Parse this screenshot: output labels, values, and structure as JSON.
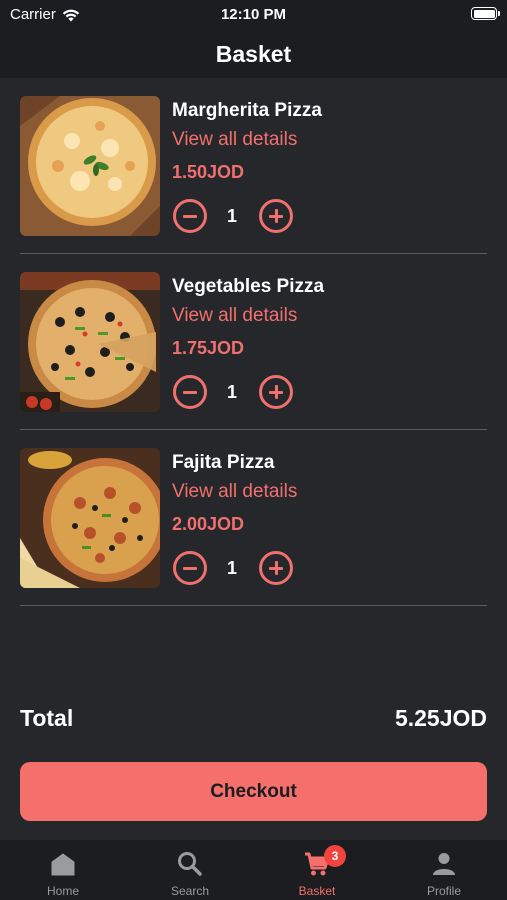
{
  "status_bar": {
    "carrier": "Carrier",
    "time": "12:10 PM"
  },
  "header": {
    "title": "Basket"
  },
  "items": [
    {
      "name": "Margherita Pizza",
      "link": "View all details",
      "price": "1.50JOD",
      "quantity": "1"
    },
    {
      "name": "Vegetables Pizza",
      "link": "View all details",
      "price": "1.75JOD",
      "quantity": "1"
    },
    {
      "name": "Fajita Pizza",
      "link": "View all details",
      "price": "2.00JOD",
      "quantity": "1"
    }
  ],
  "total": {
    "label": "Total",
    "value": "5.25JOD"
  },
  "checkout": {
    "label": "Checkout"
  },
  "tabs": [
    {
      "label": "Home",
      "icon": "home-icon"
    },
    {
      "label": "Search",
      "icon": "search-icon"
    },
    {
      "label": "Basket",
      "icon": "cart-icon",
      "badge": "3",
      "active": true
    },
    {
      "label": "Profile",
      "icon": "person-icon"
    }
  ],
  "colors": {
    "accent": "#f56f6d",
    "background": "#26272b",
    "bar": "#1c1d20",
    "badge": "#f2433f"
  }
}
